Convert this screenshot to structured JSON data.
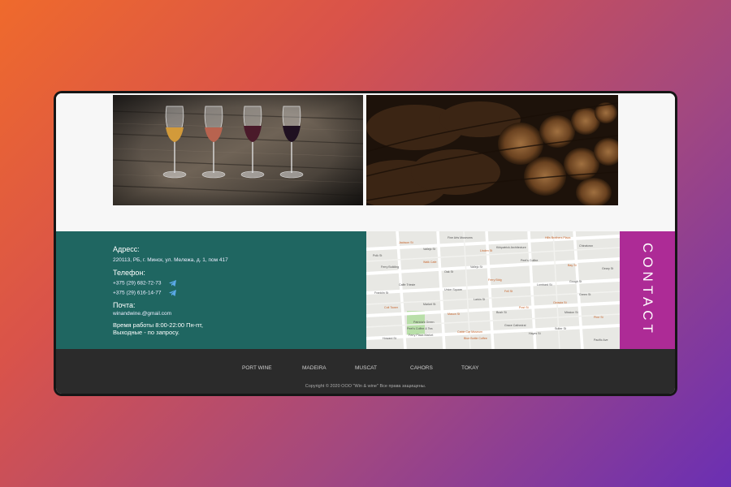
{
  "images": {
    "left_alt": "four glasses of wine on a barrel",
    "right_alt": "wine barrels in a cellar"
  },
  "contact": {
    "address_heading": "Адресс:",
    "address": "220113, РБ, г. Минск, ул. Мележа, д. 1, пом 417",
    "phone_heading": "Телефон:",
    "phone1": "+375 (29) 682-72-73",
    "phone2": "+375 (29) 616-14-77",
    "email_heading": "Почта:",
    "email": "winandwine.@gmail.com",
    "hours_line1": "Время работы 8:00-22:00 Пн-пт,",
    "hours_line2": "Выходные - по запросу.",
    "telegram_icon": "telegram-icon"
  },
  "map": {
    "labels": [
      "Jackson St",
      "Fine Arts Museums",
      "Kirkpatrick Architecture",
      "Hills Brothers Plaza",
      "Chinatown",
      "Ferry Building",
      "Walk Cafe",
      "Vallejo St",
      "Peet's Coffee",
      "Bay St",
      "Caffe Trieste",
      "Union Square",
      "Ferry Bldg",
      "Lombard St",
      "Green St",
      "Coit Tower",
      "Market St",
      "Larkin St",
      "Post St",
      "Mission St",
      "Peet's Coffee & Tea",
      "Cable Car Museum",
      "Grace Cathedral",
      "Sutter St",
      "Pine St",
      "Polk St",
      "Geary St",
      "Mason St",
      "Bush St",
      "Howard St",
      "Octavia St",
      "Pacific Ave",
      "Ferry Plaza Market",
      "Blue Bottle Coffee",
      "Vallejo St",
      "Hayes St",
      "Fell St",
      "Gough St",
      "Franklin St",
      "Linden St",
      "Oak St",
      "Patricia's Green"
    ]
  },
  "contact_tab": {
    "label": "CONTACT"
  },
  "footer": {
    "nav": [
      "PORT WINE",
      "MADEIRA",
      "MUSCAT",
      "CAHORS",
      "TOKAY"
    ],
    "copyright": "Copyright ©  2020  ООО \"Win & wine\" Все права защищены."
  },
  "colors": {
    "contact_bg": "#1f6661",
    "contact_tab_bg": "#ad2b96",
    "footer_bg": "#2b2b2b"
  }
}
